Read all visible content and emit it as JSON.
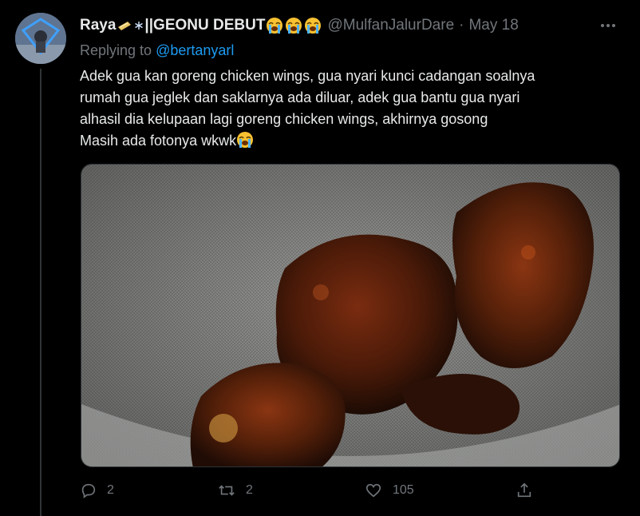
{
  "tweet": {
    "display_name": "Raya",
    "display_name_suffix": "||GEONU DEBUT",
    "name_emojis": {
      "pre": [
        "ticket",
        "snowflake"
      ],
      "post": [
        "loudly-crying-face",
        "loudly-crying-face",
        "loudly-crying-face"
      ]
    },
    "handle": "@MulfanJalurDare",
    "separator": "·",
    "date": "May 18",
    "replying_prefix": "Replying to",
    "replying_to": "@bertanyarl",
    "text_lines": [
      "Adek gua kan goreng chicken wings, gua nyari kunci cadangan soalnya",
      "rumah gua jeglek dan saklarnya ada diluar, adek gua bantu gua nyari",
      "alhasil dia kelupaan lagi goreng chicken wings, akhirnya gosong",
      "Masih ada fotonya wkwk"
    ],
    "trailing_emoji": "loudly-crying-face",
    "photo_description_icon": "burnt-chicken-wings-photo",
    "actions": {
      "reply_count": "2",
      "retweet_count": "2",
      "like_count": "105"
    }
  },
  "colors": {
    "background": "#000000",
    "text_primary": "#e7e9ea",
    "text_secondary": "#71767b",
    "link": "#1d9bf0",
    "divider": "#2f3336"
  }
}
